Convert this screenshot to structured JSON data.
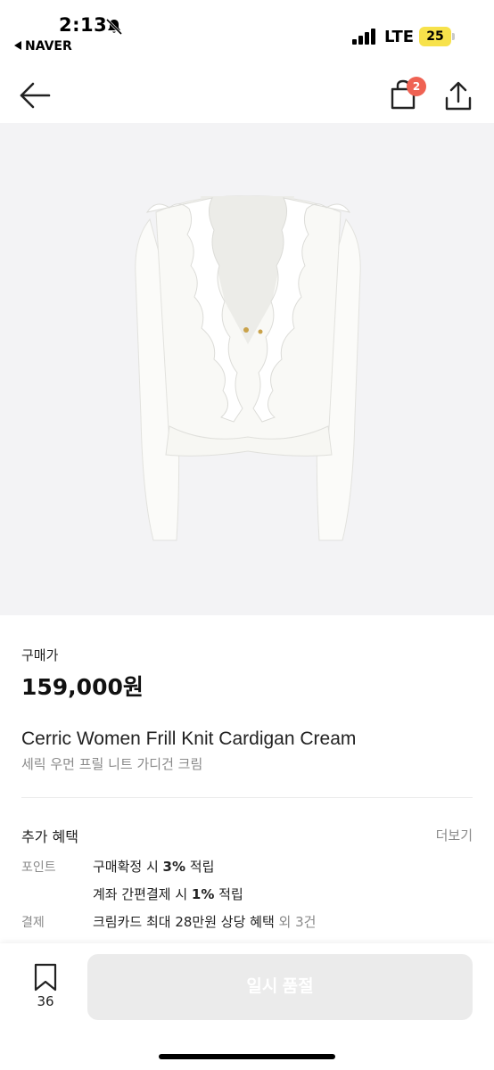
{
  "status_bar": {
    "time": "2:13",
    "back_app": "NAVER",
    "network": "LTE",
    "battery_level": "25",
    "icons": [
      "bell-muted-icon",
      "signal-icon",
      "battery-icon"
    ]
  },
  "nav": {
    "back_icon": "arrow-left-icon",
    "cart_icon": "shopping-bag-icon",
    "cart_badge": "2",
    "share_icon": "share-icon"
  },
  "product": {
    "image_alt_icon": "cardigan-image",
    "price_label": "구매가",
    "price": "159,000원",
    "title": "Cerric Women Frill Knit Cardigan Cream",
    "subtitle": "세릭 우먼 프릴 니트 가디건 크림"
  },
  "benefits": {
    "title": "추가 혜택",
    "more": "더보기",
    "point_label": "포인트",
    "point_line1_pre": "구매확정 시 ",
    "point_line1_bold": "3%",
    "point_line1_post": " 적립",
    "point_line2_pre": "계좌 간편결제 시 ",
    "point_line2_bold": "1%",
    "point_line2_post": " 적립",
    "payment_label": "결제",
    "payment_text": "크림카드 최대 28만원 상당 혜택",
    "payment_extra": " 외 3건"
  },
  "bottom_bar": {
    "wish_icon": "bookmark-icon",
    "wish_count": "36",
    "soldout_label": "일시 품절"
  },
  "colors": {
    "badge": "#ef6253",
    "battery": "#f7e24b",
    "image_bg": "#f3f3f5",
    "disabled_button": "#ebebeb",
    "muted_text": "#8a8a8a"
  }
}
